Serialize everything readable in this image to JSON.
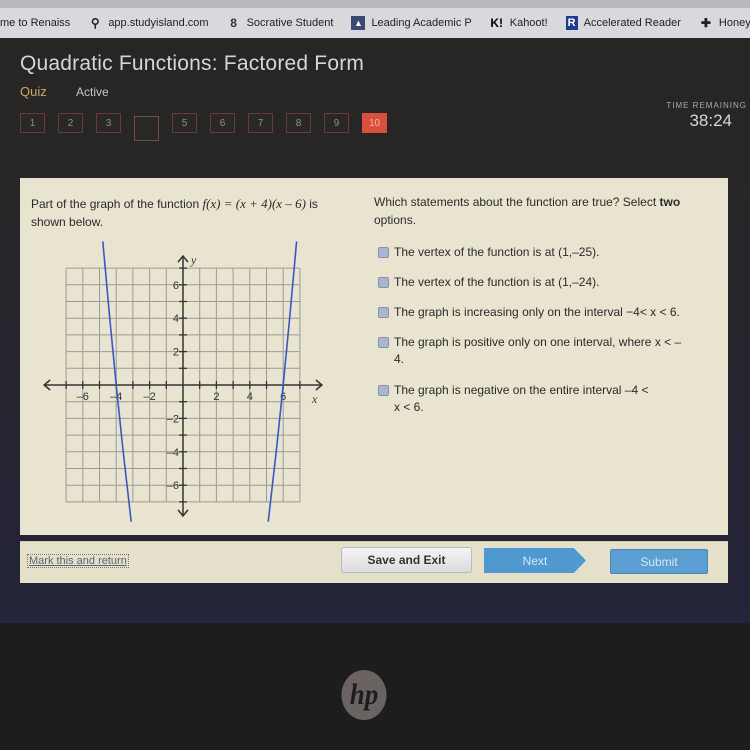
{
  "browser": {
    "bookmarks": [
      {
        "icon": "none",
        "label": "me to Renaiss"
      },
      {
        "icon": "study-island-icon",
        "label": "app.studyisland.com"
      },
      {
        "icon": "socrative-icon",
        "label": "Socrative Student"
      },
      {
        "icon": "leading-academic-icon",
        "label": "Leading Academic P"
      },
      {
        "icon": "kahoot-icon",
        "label": "Kahoot!"
      },
      {
        "icon": "accelerated-reader-icon",
        "label": "Accelerated Reader"
      },
      {
        "icon": "honey-icon",
        "label": "Honey and I"
      }
    ]
  },
  "header": {
    "title": "Quadratic Functions: Factored Form",
    "type": "Quiz",
    "status": "Active"
  },
  "question_nav": [
    {
      "label": "1",
      "state": "answered"
    },
    {
      "label": "2",
      "state": "answered"
    },
    {
      "label": "3",
      "state": "answered"
    },
    {
      "label": "",
      "state": "blank"
    },
    {
      "label": "5",
      "state": "answered"
    },
    {
      "label": "6",
      "state": "answered"
    },
    {
      "label": "7",
      "state": "answered"
    },
    {
      "label": "8",
      "state": "answered"
    },
    {
      "label": "9",
      "state": "answered"
    },
    {
      "label": "10",
      "state": "current"
    }
  ],
  "timer": {
    "label": "TIME REMAINING",
    "value": "38:24"
  },
  "question": {
    "prompt_part1": "Part of the graph of the function ",
    "function": "f(x) = (x + 4)(x – 6)",
    "prompt_part2": " is shown below.",
    "instruction_part1": "Which statements about the function are true? Select ",
    "instruction_bold": "two",
    "instruction_part2": " options.",
    "options": [
      {
        "text": "The vertex of the function is at (1,–25).",
        "checked": false
      },
      {
        "text": "The vertex of the function is at (1,–24).",
        "checked": false
      },
      {
        "text": "The graph is increasing only on the interval −4< x < 6.",
        "checked": false
      },
      {
        "text": "The graph is positive only on one interval, where x < – 4.",
        "checked": false
      },
      {
        "text": "The graph is negative on the entire interval –4 < x < 6.",
        "checked": false
      }
    ]
  },
  "chart_data": {
    "type": "line",
    "function": "f(x) = (x + 4)(x - 6)",
    "xlabel": "x",
    "ylabel": "y",
    "xlim": [
      -7,
      7
    ],
    "ylim": [
      -7,
      7
    ],
    "grid": true,
    "x_tick_labels": [
      "–6",
      "–4",
      "–2",
      "2",
      "4",
      "6"
    ],
    "x_tick_values": [
      -6,
      -4,
      -2,
      2,
      4,
      6
    ],
    "y_tick_labels": [
      "6",
      "4",
      "2",
      "–2",
      "–4",
      "–6"
    ],
    "y_tick_values": [
      6,
      4,
      2,
      -2,
      -4,
      -6
    ],
    "roots": [
      -4,
      6
    ],
    "series": [
      {
        "name": "left branch",
        "points": [
          [
            -4.8,
            8.6
          ],
          [
            -4.4,
            4.16
          ],
          [
            -4.0,
            0
          ],
          [
            -3.6,
            -3.84
          ],
          [
            -3.2,
            -7.36
          ],
          [
            -3.1,
            -8.19
          ]
        ]
      },
      {
        "name": "right branch",
        "points": [
          [
            5.1,
            -8.19
          ],
          [
            5.2,
            -7.36
          ],
          [
            5.6,
            -3.84
          ],
          [
            6.0,
            0
          ],
          [
            6.4,
            4.16
          ],
          [
            6.8,
            8.6
          ]
        ]
      }
    ],
    "line_color": "#3b57c4"
  },
  "footer": {
    "mark_label": "Mark this and return",
    "save_label": "Save and Exit",
    "next_label": "Next",
    "submit_label": "Submit"
  },
  "device": {
    "logo": "hp"
  }
}
